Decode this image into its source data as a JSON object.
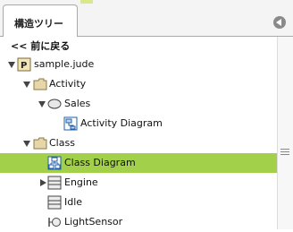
{
  "tab": {
    "label": "構造ツリー"
  },
  "back": {
    "label": "<< 前に戻る"
  },
  "tree": {
    "root": {
      "label": "sample.jude"
    },
    "activity": {
      "label": "Activity"
    },
    "sales": {
      "label": "Sales"
    },
    "activity_diagram": {
      "label": "Activity Diagram"
    },
    "class": {
      "label": "Class"
    },
    "class_diagram": {
      "label": "Class Diagram"
    },
    "engine": {
      "label": "Engine"
    },
    "idle": {
      "label": "Idle"
    },
    "light_sensor": {
      "label": "LightSensor"
    }
  },
  "colors": {
    "selection": "#a3d04a",
    "folder": "#e7d7a8"
  }
}
